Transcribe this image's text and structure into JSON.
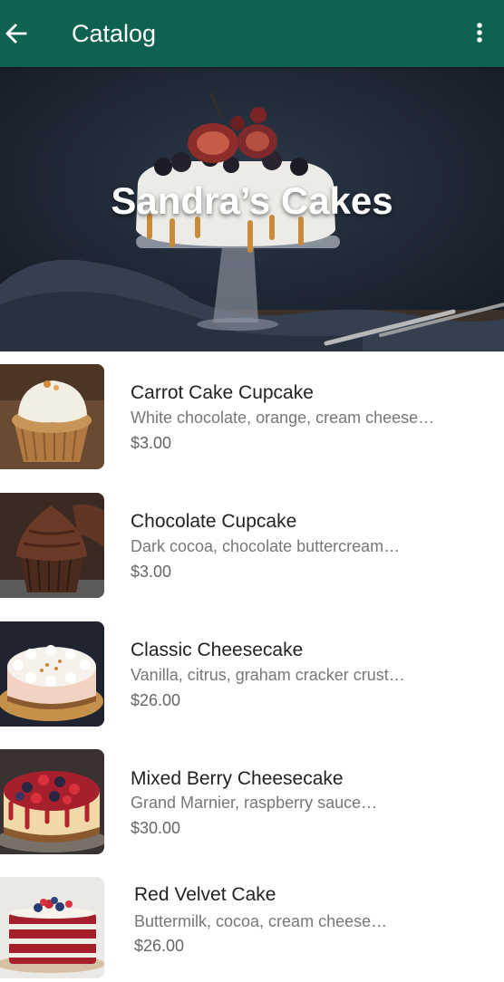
{
  "appbar": {
    "back_icon": "arrow-back-icon",
    "title": "Catalog",
    "more_icon": "more-vert-icon",
    "color": "#0f6152"
  },
  "hero": {
    "title": "Sandra’s Cakes"
  },
  "products": [
    {
      "name": "Carrot Cake Cupcake",
      "description": "White chocolate, orange, cream cheese…",
      "price": "$3.00"
    },
    {
      "name": "Chocolate Cupcake",
      "description": "Dark cocoa, chocolate buttercream…",
      "price": "$3.00"
    },
    {
      "name": "Classic Cheesecake",
      "description": "Vanilla, citrus, graham cracker crust…",
      "price": "$26.00"
    },
    {
      "name": "Mixed Berry Cheesecake",
      "description": "Grand Marnier, raspberry sauce…",
      "price": "$30.00"
    },
    {
      "name": "Red Velvet Cake",
      "description": "Buttermilk, cocoa, cream cheese…",
      "price": "$26.00"
    }
  ]
}
